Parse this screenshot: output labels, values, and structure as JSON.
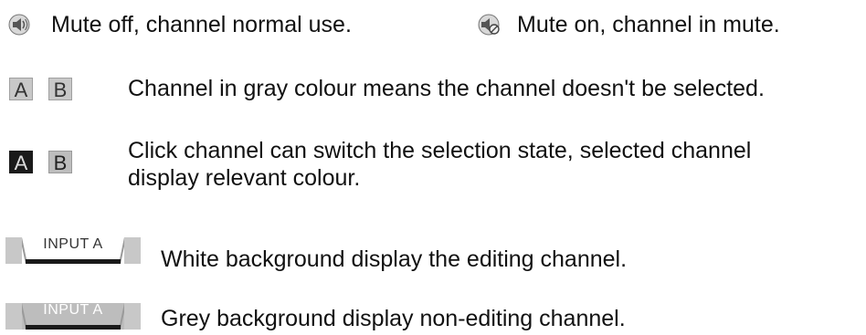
{
  "rows": {
    "mute_off_text": "Mute off, channel normal use.",
    "mute_on_text": "Mute on, channel in mute.",
    "gray_channel_text": "Channel in gray colour means the channel doesn't be selected.",
    "click_channel_line1": "Click channel can switch the selection state, selected channel",
    "click_channel_line2": "display relevant colour.",
    "white_bg_text": "White background display the editing channel.",
    "grey_bg_text": "Grey background display non-editing channel."
  },
  "channels": {
    "a_label": "A",
    "b_label": "B"
  },
  "tabs": {
    "editing_label": "INPUT A",
    "non_editing_label": "INPUT A"
  },
  "icons": {
    "mute_off": "speaker-icon",
    "mute_on": "speaker-muted-icon"
  },
  "colors": {
    "text": "#111111",
    "channel_unselected": "#c8c8c8",
    "channel_selected": "#1a1a1a",
    "tab_editing_bg": "#ffffff",
    "tab_non_editing_bg": "#bdbdbd"
  }
}
